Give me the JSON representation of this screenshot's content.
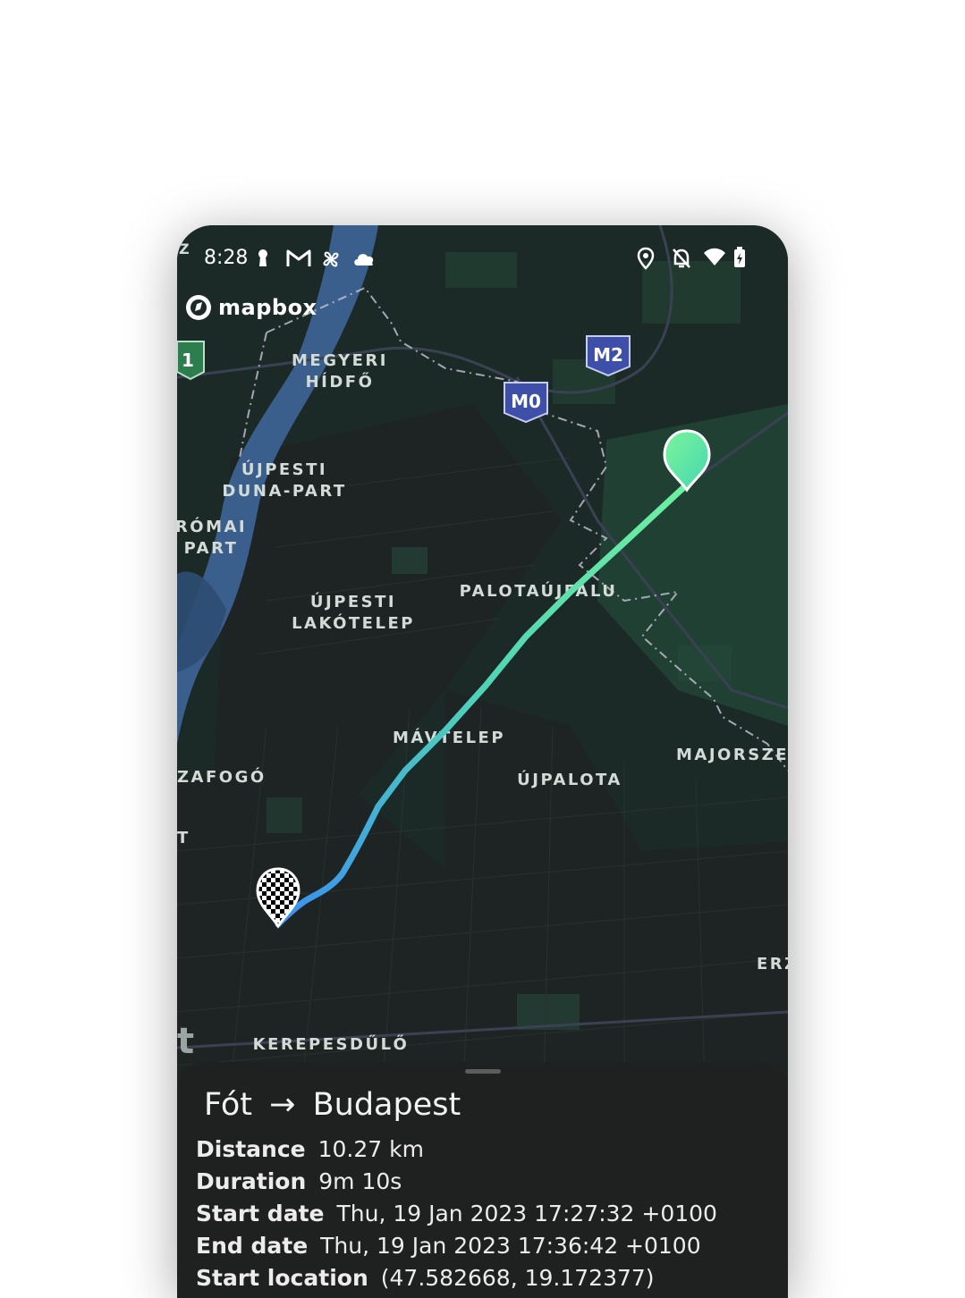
{
  "status_bar": {
    "time": "8:28",
    "icons_left": [
      "keyhole-icon",
      "gmail-icon",
      "pinwheel-icon",
      "cloud-icon"
    ],
    "icons_right": [
      "location-icon",
      "bell-off-icon",
      "wifi-icon",
      "battery-charging-icon"
    ]
  },
  "map": {
    "attribution": "mapbox",
    "shields": [
      "M2",
      "M0",
      "1"
    ],
    "labels": [
      "MEGYERI",
      "HÍDFŐ",
      "ÚJPESTI",
      "DUNA-PART",
      "RÓMAI",
      "PART",
      "ÚJPESTI",
      "LAKÓTELEP",
      "PALOTAÚJFALU",
      "MÁVTELEP",
      "ÚJPALOTA",
      "MAJORSZEG",
      "ZAFOGÓ",
      "T",
      "ERZ",
      "KEREPESDŰLŐ",
      "t",
      "Z"
    ],
    "colors": {
      "land": "#1c2a27",
      "water": "#3b5f8c",
      "route_start": "#6ff0a0",
      "route_end": "#3a8ff0"
    }
  },
  "trip": {
    "from": "Fót",
    "arrow": "→",
    "to": "Budapest",
    "details": [
      {
        "label": "Distance",
        "value": "10.27 km"
      },
      {
        "label": "Duration",
        "value": "9m 10s"
      },
      {
        "label": "Start date",
        "value": "Thu, 19 Jan 2023 17:27:32 +0100"
      },
      {
        "label": "End date",
        "value": "Thu, 19 Jan 2023 17:36:42 +0100"
      },
      {
        "label": "Start location",
        "value": "(47.582668, 19.172377)"
      }
    ]
  }
}
